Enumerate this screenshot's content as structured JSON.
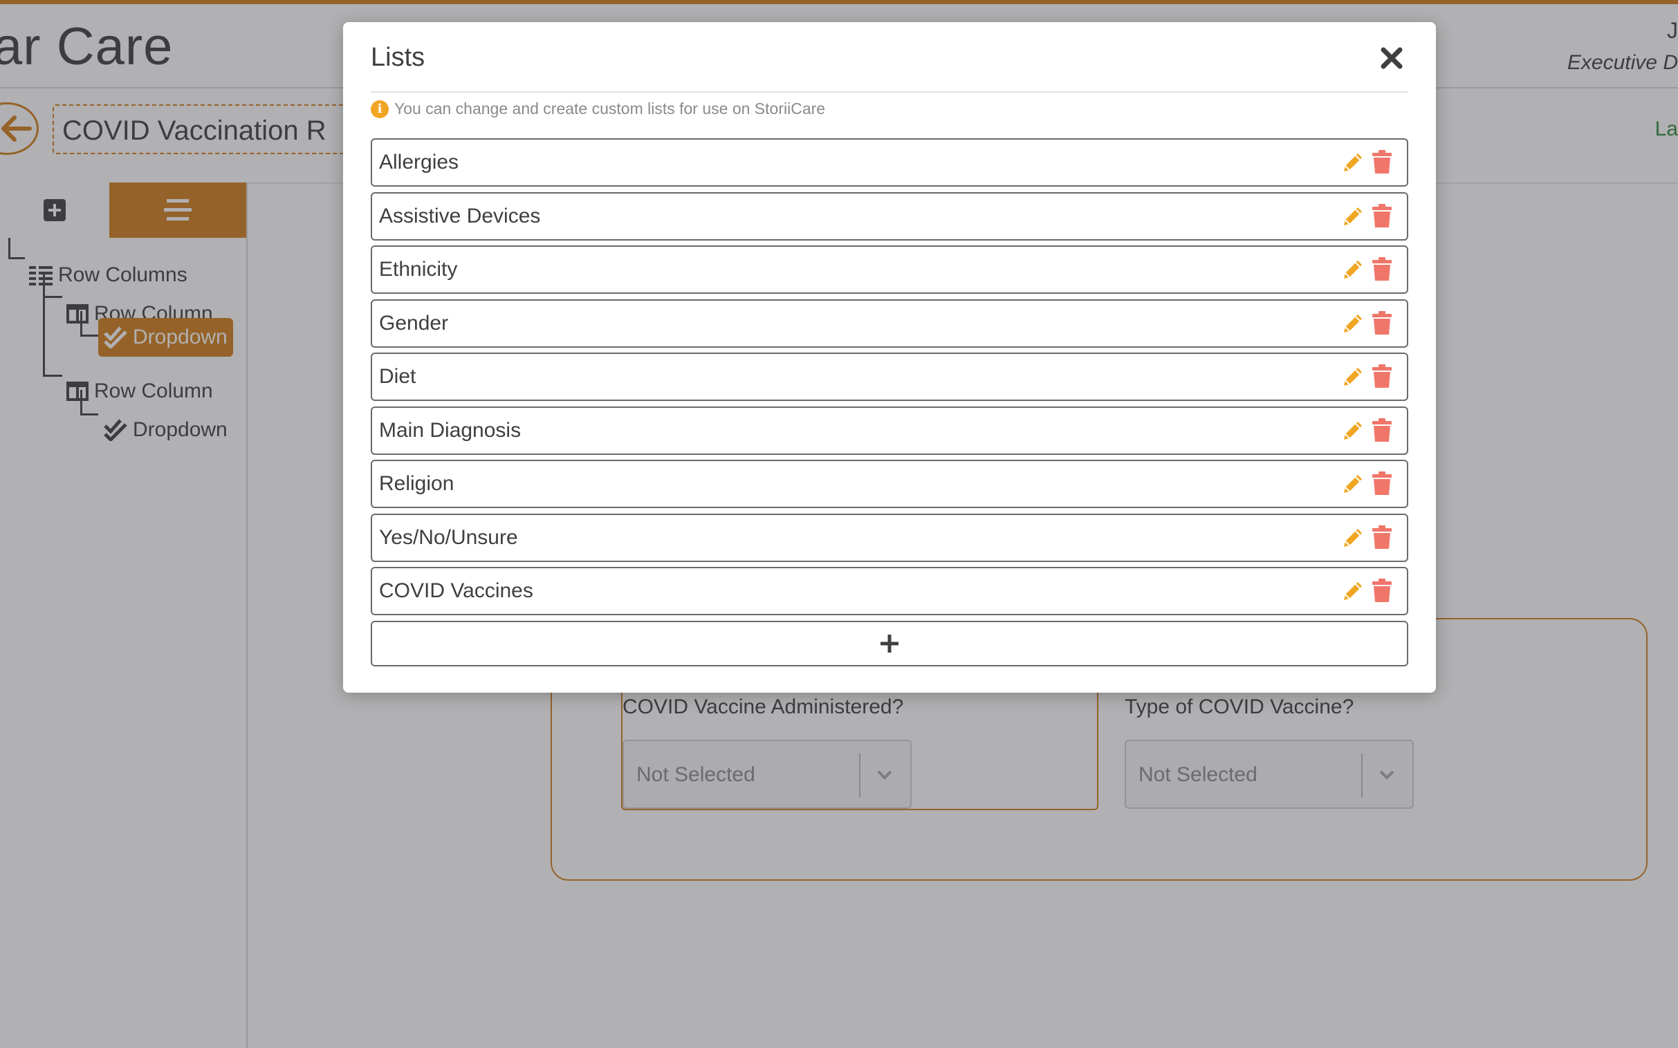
{
  "app": {
    "title": "ar Care",
    "user_name": "J",
    "user_role": "Executive D",
    "form_title": "COVID Vaccination R",
    "last_saved": "La"
  },
  "sidebar": {
    "tree": [
      {
        "label": "Row Columns",
        "icon": "row-columns-icon"
      },
      {
        "label": "Row Column",
        "icon": "column-icon"
      },
      {
        "label": "Dropdown",
        "icon": "checks-icon",
        "selected": true
      },
      {
        "label": "Row Column",
        "icon": "column-icon"
      },
      {
        "label": "Dropdown",
        "icon": "checks-icon"
      }
    ]
  },
  "canvas": {
    "field1_label": "COVID Vaccine Administered?",
    "field1_value": "Not Selected",
    "field2_label": "Type of COVID Vaccine?",
    "field2_value": "Not Selected"
  },
  "modal": {
    "title": "Lists",
    "info": "You can change and create custom lists for use on StoriiCare",
    "lists": [
      {
        "label": "Allergies"
      },
      {
        "label": "Assistive Devices"
      },
      {
        "label": "Ethnicity"
      },
      {
        "label": "Gender"
      },
      {
        "label": "Diet"
      },
      {
        "label": "Main Diagnosis"
      },
      {
        "label": "Religion"
      },
      {
        "label": "Yes/No/Unsure"
      },
      {
        "label": "COVID Vaccines"
      }
    ]
  },
  "colors": {
    "accent": "#d17f1b",
    "edit": "#f0a623",
    "delete": "#f0766a",
    "overlay": "rgba(60,58,62,0.4)"
  }
}
